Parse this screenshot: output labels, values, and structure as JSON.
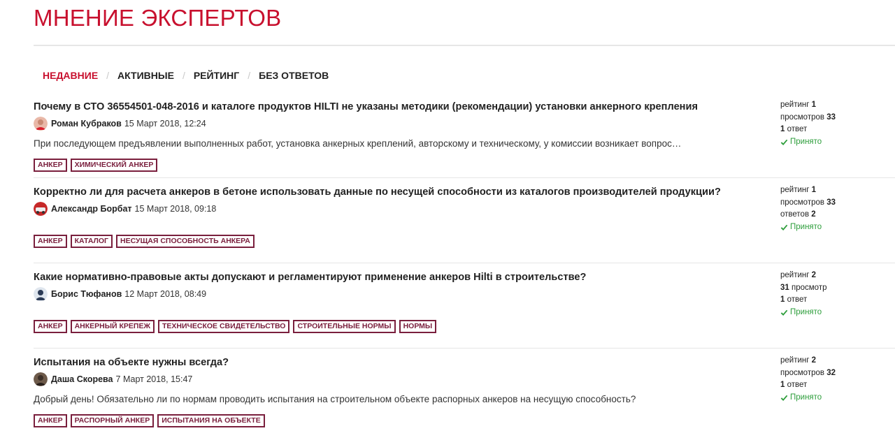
{
  "page": {
    "title": "МНЕНИЕ ЭКСПЕРТОВ"
  },
  "tabs": [
    {
      "label": "НЕДАВНИЕ",
      "active": true
    },
    {
      "label": "АКТИВНЫЕ",
      "active": false
    },
    {
      "label": "РЕЙТИНГ",
      "active": false
    },
    {
      "label": "БЕЗ ОТВЕТОВ",
      "active": false
    }
  ],
  "tab_separator": "/",
  "colors": {
    "accent": "#c8102e",
    "tag": "#7a1f3d",
    "accepted": "#2e9e3c"
  },
  "questions": [
    {
      "title": "Почему в СТО 36554501-048-2016 и каталоге продуктов HILTI не указаны методики (рекомендации) установки анкерного крепления",
      "author": "Роман Кубраков",
      "date": "15 Март 2018, 12:24",
      "excerpt": "При последующем предъявлении выполненных работ, установка анкерных креплений, авторскому и техническому, у комиссии возникает вопрос…",
      "tags": [
        "АНКЕР",
        "ХИМИЧЕСКИЙ АНКЕР"
      ],
      "stats": {
        "rating_label": "рейтинг",
        "rating": "1",
        "views_label": "просмотров",
        "views": "33",
        "answers": "1",
        "answers_label": "ответ",
        "accepted": "Принято"
      }
    },
    {
      "title": "Корректно ли для расчета анкеров в бетоне использовать данные по несущей способности из каталогов производителей продукции?",
      "author": "Александр Борбат",
      "date": "15 Март 2018, 09:18",
      "excerpt": "",
      "tags": [
        "АНКЕР",
        "КАТАЛОГ",
        "НЕСУЩАЯ СПОСОБНОСТЬ АНКЕРА"
      ],
      "stats": {
        "rating_label": "рейтинг",
        "rating": "1",
        "views_label": "просмотров",
        "views": "33",
        "answers_label": "ответов",
        "answers": "2",
        "accepted": "Принято"
      }
    },
    {
      "title": "Какие нормативно-правовые акты допускают и регламентируют применение анкеров Hilti в строительстве?",
      "author": "Борис Тюфанов",
      "date": "12 Март 2018, 08:49",
      "excerpt": "",
      "tags": [
        "АНКЕР",
        "АНКЕРНЫЙ КРЕПЕЖ",
        "ТЕХНИЧЕСКОЕ СВИДЕТЕЛЬСТВО",
        "СТРОИТЕЛЬНЫЕ НОРМЫ",
        "НОРМЫ"
      ],
      "stats": {
        "rating_label": "рейтинг",
        "rating": "2",
        "views": "31",
        "views_label": "просмотр",
        "answers": "1",
        "answers_label": "ответ",
        "accepted": "Принято"
      }
    },
    {
      "title": "Испытания на объекте нужны всегда?",
      "author": "Даша Скорева",
      "date": "7 Март 2018, 15:47",
      "excerpt": "Добрый день! Обязательно ли по нормам проводить испытания на строительном объекте распорных анкеров на несущую способность?",
      "tags": [
        "АНКЕР",
        "РАСПОРНЫЙ АНКЕР",
        "ИСПЫТАНИЯ НА ОБЪЕКТЕ"
      ],
      "stats": {
        "rating_label": "рейтинг",
        "rating": "2",
        "views_label": "просмотров",
        "views": "32",
        "answers": "1",
        "answers_label": "ответ",
        "accepted": "Принято"
      }
    }
  ]
}
